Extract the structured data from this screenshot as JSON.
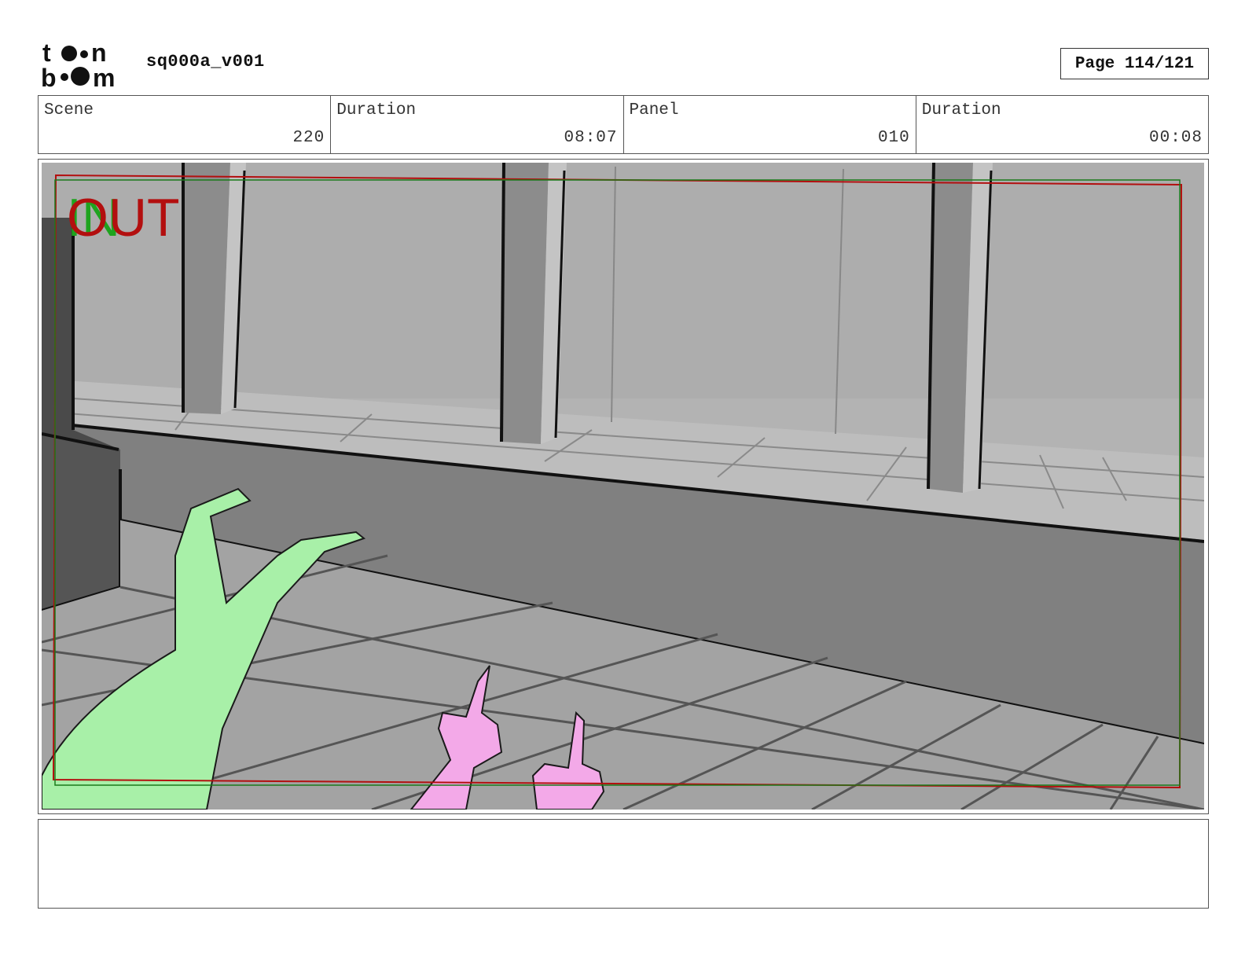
{
  "header": {
    "logo_text_top": "toon",
    "logo_text_bottom": "boom",
    "project_name": "sq000a_v001",
    "page_label": "Page 114/121"
  },
  "info": [
    {
      "label": "Scene",
      "value": "220"
    },
    {
      "label": "Duration",
      "value": "08:07"
    },
    {
      "label": "Panel",
      "value": "010"
    },
    {
      "label": "Duration",
      "value": "00:08"
    }
  ],
  "panel": {
    "in_label": "IN",
    "out_label": "OUT",
    "in_color": "#1fa31f",
    "out_color": "#b30f0f"
  },
  "notes": {
    "text": ""
  }
}
